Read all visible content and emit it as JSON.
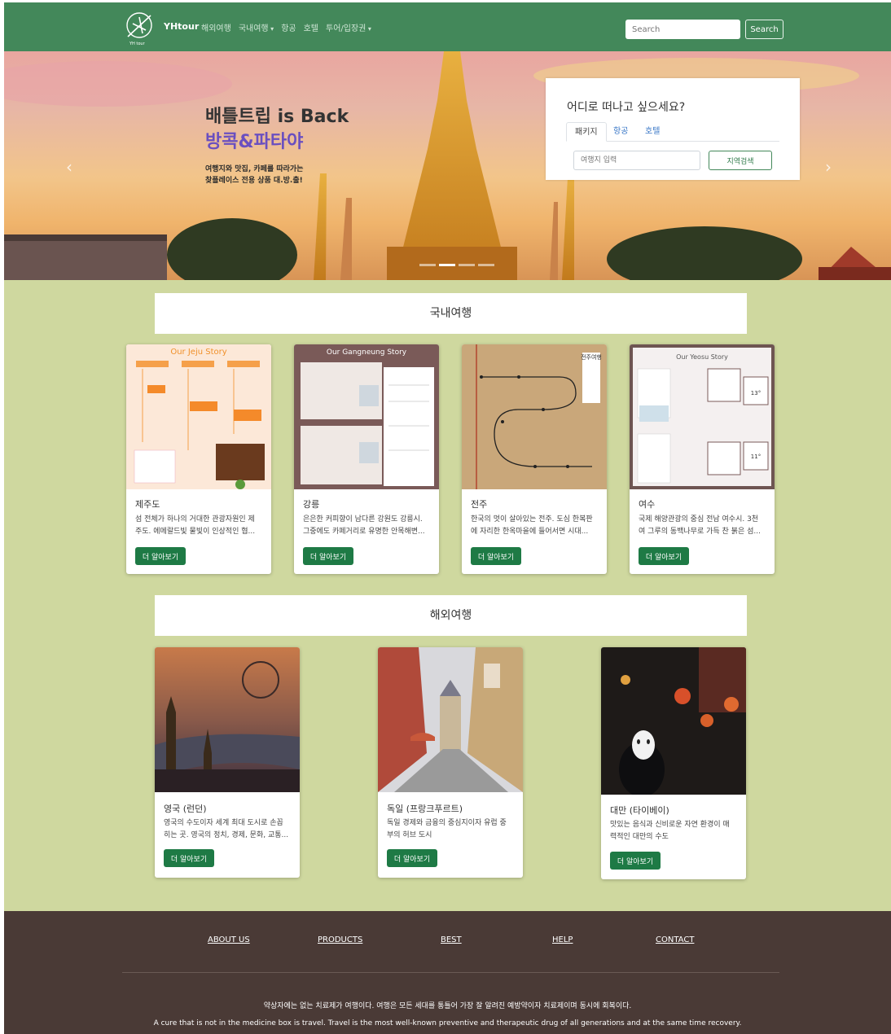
{
  "navbar": {
    "brand": "YHtour",
    "items": [
      {
        "label": "해외여행",
        "dropdown": false
      },
      {
        "label": "국내여행",
        "dropdown": true
      },
      {
        "label": "항공",
        "dropdown": false
      },
      {
        "label": "호텔",
        "dropdown": false
      },
      {
        "label": "투어/입장권",
        "dropdown": true
      }
    ],
    "search_placeholder": "Search",
    "search_button": "Search"
  },
  "hero": {
    "title_line1": "배틀트립 is Back",
    "title_line2": "방콕&파타야",
    "desc_line1": "여행지와 맛집, 카페를 따라가는",
    "desc_line2": "찾플레이스 전용 상품 대.방.출!",
    "prev_icon": "‹",
    "next_icon": "›",
    "slides_count": 4,
    "active_slide": 1
  },
  "search_card": {
    "title": "어디로 떠나고 싶으세요?",
    "tabs": [
      "패키지",
      "항공",
      "호텔"
    ],
    "active_tab": 0,
    "input_placeholder": "여행지 입력",
    "button": "지역검색"
  },
  "domestic": {
    "header": "국내여행",
    "cards": [
      {
        "img_title": "Our Jeju Story",
        "title": "제주도",
        "text_1": "섬 전체가 하나의 거대한 관광자원인 제",
        "text_2": "주도. 에메랄드빛 물빛이 인상적인 협...",
        "button": "더 알아보기"
      },
      {
        "img_title": "Our Gangneung Story",
        "title": "강릉",
        "text_1": "은은한 커피향이 남다른 강원도 강릉시.",
        "text_2": "그중에도 카페거리로 유명한 안목해변...",
        "button": "더 알아보기"
      },
      {
        "img_title": "전주여행",
        "title": "전주",
        "text_1": "한국의 멋이 살아있는 전주. 도심 한복판",
        "text_2": "에 자리한 한옥마을에 들어서면 시대...",
        "button": "더 알아보기"
      },
      {
        "img_title": "Our Yeosu Story",
        "title": "여수",
        "text_1": "국제 해양관광의 중심 전남 여수시. 3천",
        "text_2": "여 그루의 동백나무로 가득 찬 붉은 섬...",
        "button": "더 알아보기"
      }
    ]
  },
  "overseas": {
    "header": "해외여행",
    "cards": [
      {
        "title": "영국 (런던)",
        "text_1": "영국의 수도이자 세계 최대 도시로 손꼽",
        "text_2": "히는 곳. 영국의 정치, 경제, 문화, 교통...",
        "button": "더 알아보기"
      },
      {
        "title": "독일 (프랑크푸르트)",
        "text_1": "독일 경제와 금융의 중심지이자 유럽 중",
        "text_2": "부의 허브 도시",
        "button": "더 알아보기"
      },
      {
        "title": "대만 (타이베이)",
        "text_1": "맛있는 음식과 신비로운 자연 환경이 매",
        "text_2": "력적인 대만의 수도",
        "button": "더 알아보기"
      }
    ]
  },
  "footer": {
    "links": [
      "ABOUT US",
      "PRODUCTS",
      "BEST",
      "HELP",
      "CONTACT"
    ],
    "text_ko": "약상자에는 없는 치료제가 여행이다. 여행은 모든 세대를 통틀어 가장 잘 알려진 예방약이자 치료제이며 동시에 회복이다.",
    "text_en": "A cure that is not in the medicine box is travel. Travel is the most well-known preventive and therapeutic drug of all generations and at the same time recovery."
  },
  "colors": {
    "navbar": "#43885a",
    "main_bg": "#cfd89f",
    "footer_bg": "#4a3a36",
    "button_green": "#1e7a45",
    "hero_accent_purple": "#6a4fc0"
  }
}
